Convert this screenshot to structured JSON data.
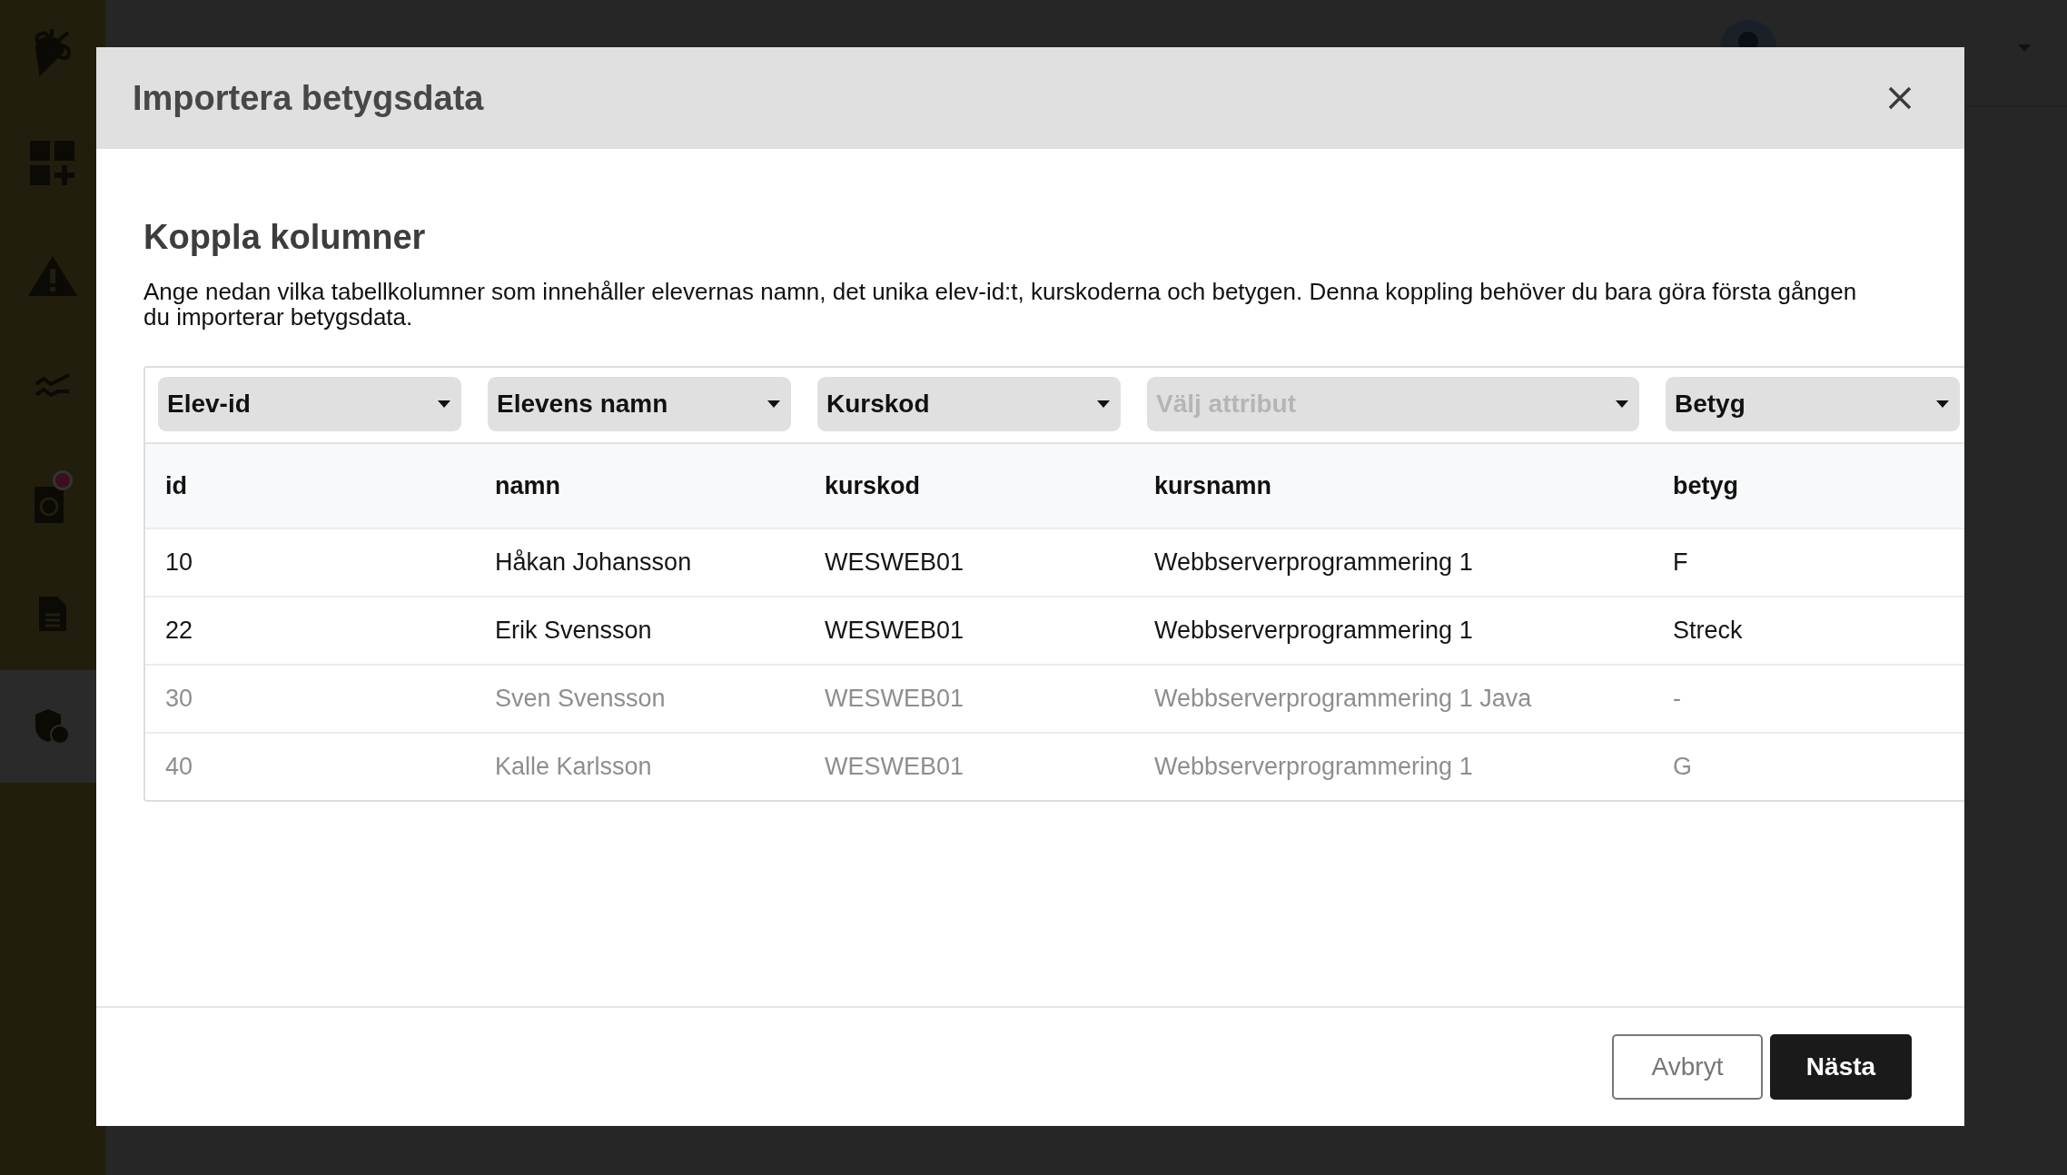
{
  "sidebar": {
    "items": [
      {
        "selected": false,
        "notification": false
      },
      {
        "selected": false,
        "notification": false
      },
      {
        "selected": false,
        "notification": false
      },
      {
        "selected": false,
        "notification": true
      },
      {
        "selected": false,
        "notification": false
      },
      {
        "selected": true,
        "notification": false
      }
    ]
  },
  "dialog": {
    "title": "Importera betygsdata",
    "section_title": "Koppla kolumner",
    "description": "Ange nedan vilka tabellkolumner som innehåller elevernas namn, det unika elev-id:t, kurskoderna och betygen. Denna koppling behöver du bara göra första gången du importerar betygsdata.",
    "column_selects": [
      {
        "value": "Elev-id"
      },
      {
        "value": "Elevens namn"
      },
      {
        "value": "Kurskod"
      },
      {
        "placeholder": "Välj attribut"
      },
      {
        "value": "Betyg"
      }
    ],
    "columns": [
      "id",
      "namn",
      "kurskod",
      "kursnamn",
      "betyg"
    ],
    "rows": [
      {
        "faded": false,
        "cells": [
          "10",
          "Håkan Johansson",
          "WESWEB01",
          "Webbserverprogrammering 1",
          "F"
        ]
      },
      {
        "faded": false,
        "cells": [
          "22",
          "Erik Svensson",
          "WESWEB01",
          "Webbserverprogrammering 1",
          "Streck"
        ]
      },
      {
        "faded": true,
        "cells": [
          "30",
          "Sven Svensson",
          "WESWEB01",
          "Webbserverprogrammering 1 Java",
          "-"
        ]
      },
      {
        "faded": true,
        "cells": [
          "40",
          "Kalle Karlsson",
          "WESWEB01",
          "Webbserverprogrammering 1",
          "G"
        ]
      }
    ],
    "buttons": [
      {
        "label": "Avbryt",
        "kind": "secondary"
      },
      {
        "label": "Nästa",
        "kind": "primary"
      }
    ]
  }
}
